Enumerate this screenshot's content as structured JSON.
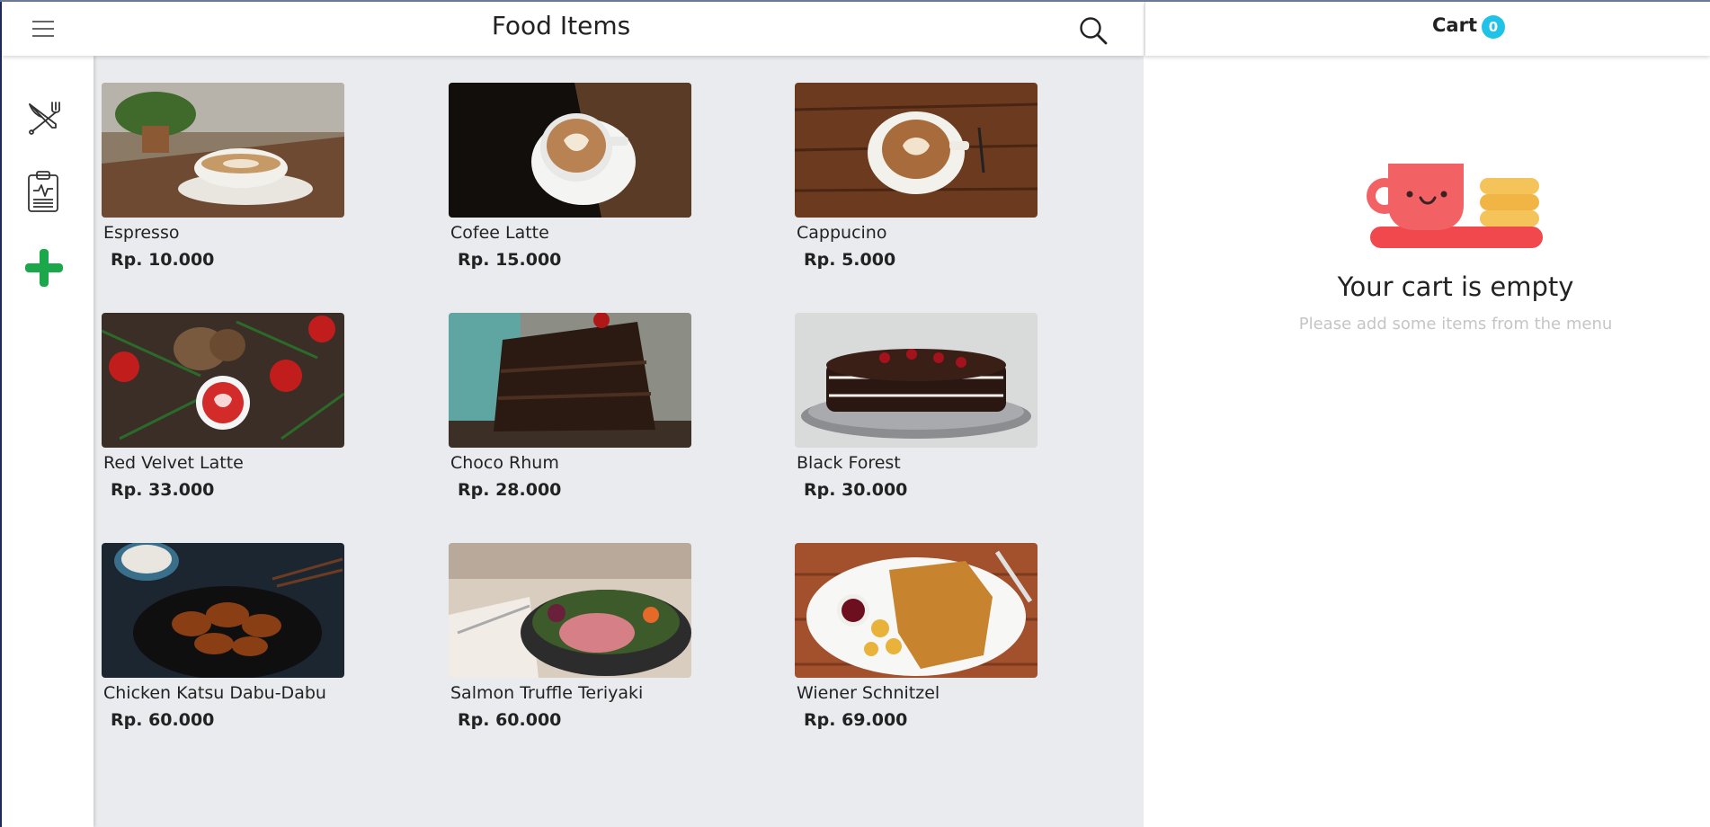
{
  "header": {
    "title": "Food Items",
    "menu_icon": "hamburger-menu-icon",
    "search_icon": "search-icon"
  },
  "cart": {
    "title": "Cart",
    "count": "0",
    "empty_title": "Your cart is empty",
    "empty_subtitle": "Please add some items from the menu",
    "badge_color": "#1fc3e8"
  },
  "sidebar": {
    "items": [
      {
        "icon": "fork-knife-icon",
        "active": true
      },
      {
        "icon": "report-clipboard-icon",
        "active": false
      },
      {
        "icon": "add-plus-icon",
        "active": false,
        "color": "#1aa84a"
      }
    ]
  },
  "products": [
    {
      "name": "Espresso",
      "price": "Rp. 10.000",
      "image": "espresso-cup-image"
    },
    {
      "name": "Cofee Latte",
      "price": "Rp. 15.000",
      "image": "latte-art-image"
    },
    {
      "name": "Cappucino",
      "price": "Rp. 5.000",
      "image": "cappuccino-image"
    },
    {
      "name": "Red Velvet Latte",
      "price": "Rp. 33.000",
      "image": "red-velvet-latte-image"
    },
    {
      "name": "Choco Rhum",
      "price": "Rp. 28.000",
      "image": "chocolate-cake-slice-image"
    },
    {
      "name": "Black Forest",
      "price": "Rp. 30.000",
      "image": "black-forest-cake-image"
    },
    {
      "name": "Chicken Katsu Dabu-Dabu",
      "price": "Rp. 60.000",
      "image": "chicken-katsu-image"
    },
    {
      "name": "Salmon Truffle Teriyaki",
      "price": "Rp. 60.000",
      "image": "salmon-bowl-image"
    },
    {
      "name": "Wiener Schnitzel",
      "price": "Rp. 69.000",
      "image": "schnitzel-plate-image"
    }
  ],
  "colors": {
    "main_bg": "#e9ebee",
    "accent_green": "#1aa84a"
  }
}
